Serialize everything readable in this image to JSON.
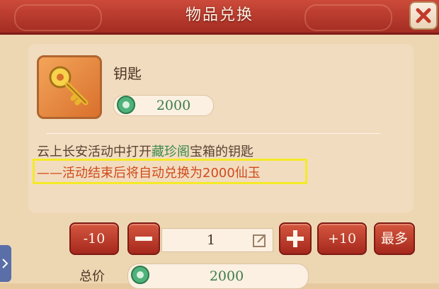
{
  "dialog": {
    "title": "物品兑换"
  },
  "item": {
    "name": "钥匙",
    "price": "2000",
    "description_pre": "云上长安活动中打开",
    "description_highlight": "藏珍阁",
    "description_post": "宝箱的钥匙",
    "note": "——活动结束后将自动兑换为2000仙玉"
  },
  "controls": {
    "minus10_label": "-10",
    "quantity": "1",
    "plus10_label": "+10",
    "max_label": "最多"
  },
  "total": {
    "label": "总价",
    "value": "2000"
  },
  "colors": {
    "accent_red": "#b83224",
    "jade_green": "#3b7a4a",
    "highlight_yellow": "#f4ea26"
  }
}
